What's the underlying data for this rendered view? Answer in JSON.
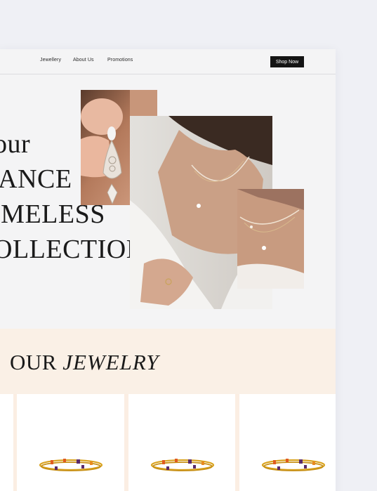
{
  "nav": {
    "links": [
      "Jewellery",
      "About Us",
      "Promotions"
    ],
    "cta": "Shop Now"
  },
  "hero": {
    "lines": [
      "our",
      "IANCE",
      "IMELESS",
      "OLLECTION."
    ],
    "photos": [
      "earring-closeup",
      "necklace-portrait",
      "necklace-detail"
    ]
  },
  "section": {
    "title_plain": "OUR",
    "title_italic": "JEWELRY"
  },
  "products": {
    "cards": [
      {
        "image": "gemstone-bangles"
      },
      {
        "image": "gemstone-bangles"
      },
      {
        "image": "gemstone-bangles"
      }
    ]
  },
  "colors": {
    "page_bg": "#eff0f5",
    "site_bg": "#f4f4f5",
    "band_bg": "#faf0e6",
    "button": "#141414",
    "text": "#1a1a1a",
    "gold": "#d9a31f"
  }
}
